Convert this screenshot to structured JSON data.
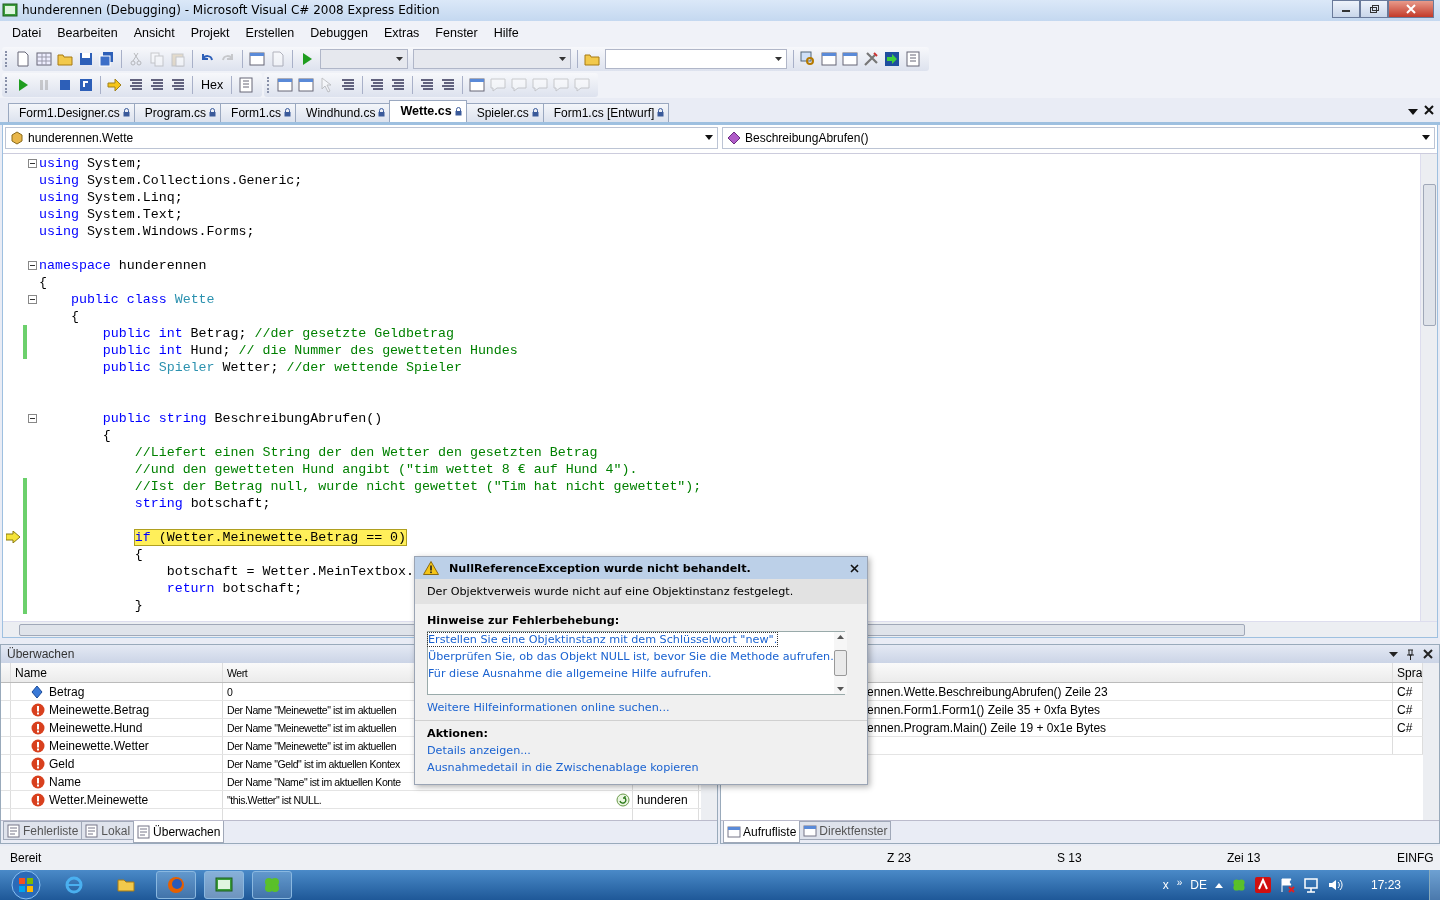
{
  "window": {
    "title": "hunderennen (Debugging) - Microsoft Visual C# 2008 Express Edition"
  },
  "menu": [
    "Datei",
    "Bearbeiten",
    "Ansicht",
    "Projekt",
    "Erstellen",
    "Debuggen",
    "Extras",
    "Fenster",
    "Hilfe"
  ],
  "toolbar": {
    "hex_button": "Hex"
  },
  "tabs": [
    {
      "label": "Form1.Designer.cs",
      "selected": false
    },
    {
      "label": "Program.cs",
      "selected": false
    },
    {
      "label": "Form1.cs",
      "selected": false
    },
    {
      "label": "Windhund.cs",
      "selected": false
    },
    {
      "label": "Wette.cs",
      "selected": true
    },
    {
      "label": "Spieler.cs",
      "selected": false
    },
    {
      "label": "Form1.cs [Entwurf]",
      "selected": false
    }
  ],
  "navigation": {
    "type": "hunderennen.Wette",
    "member": "BeschreibungAbrufen()"
  },
  "code": {
    "lines": [
      {
        "kind": "code",
        "fold": true,
        "changed": false,
        "current": false,
        "segments": [
          {
            "kind": "keyword",
            "text": "using"
          },
          {
            "kind": "plain",
            "text": " System;"
          }
        ]
      },
      {
        "kind": "code",
        "fold": false,
        "changed": false,
        "current": false,
        "segments": [
          {
            "kind": "keyword",
            "text": "using"
          },
          {
            "kind": "plain",
            "text": " System.Collections.Generic;"
          }
        ]
      },
      {
        "kind": "code",
        "fold": false,
        "changed": false,
        "current": false,
        "segments": [
          {
            "kind": "keyword",
            "text": "using"
          },
          {
            "kind": "plain",
            "text": " System.Linq;"
          }
        ]
      },
      {
        "kind": "code",
        "fold": false,
        "changed": false,
        "current": false,
        "segments": [
          {
            "kind": "keyword",
            "text": "using"
          },
          {
            "kind": "plain",
            "text": " System.Text;"
          }
        ]
      },
      {
        "kind": "code",
        "fold": false,
        "changed": false,
        "current": false,
        "segments": [
          {
            "kind": "keyword",
            "text": "using"
          },
          {
            "kind": "plain",
            "text": " System.Windows.Forms;"
          }
        ]
      },
      {
        "kind": "blank",
        "changed": false
      },
      {
        "kind": "code",
        "fold": true,
        "changed": false,
        "current": false,
        "segments": [
          {
            "kind": "keyword",
            "text": "namespace"
          },
          {
            "kind": "plain",
            "text": " hunderennen"
          }
        ]
      },
      {
        "kind": "code",
        "fold": false,
        "changed": false,
        "current": false,
        "segments": [
          {
            "kind": "plain",
            "text": "{"
          }
        ]
      },
      {
        "kind": "code",
        "fold": true,
        "changed": false,
        "current": false,
        "segments": [
          {
            "kind": "keyword",
            "text": "    public class"
          },
          {
            "kind": "type",
            "text": " Wette"
          }
        ]
      },
      {
        "kind": "code",
        "fold": false,
        "changed": false,
        "current": false,
        "segments": [
          {
            "kind": "plain",
            "text": "    {"
          }
        ]
      },
      {
        "kind": "code",
        "fold": false,
        "changed": true,
        "current": false,
        "segments": [
          {
            "kind": "keyword",
            "text": "        public int"
          },
          {
            "kind": "plain",
            "text": " Betrag; "
          },
          {
            "kind": "comment",
            "text": "//der gesetzte Geldbetrag"
          }
        ]
      },
      {
        "kind": "code",
        "fold": false,
        "changed": true,
        "current": false,
        "segments": [
          {
            "kind": "keyword",
            "text": "        public int"
          },
          {
            "kind": "plain",
            "text": " Hund; "
          },
          {
            "kind": "comment",
            "text": "// die Nummer des gewetteten Hundes"
          }
        ]
      },
      {
        "kind": "code",
        "fold": false,
        "changed": false,
        "current": false,
        "segments": [
          {
            "kind": "keyword",
            "text": "        public"
          },
          {
            "kind": "type",
            "text": " Spieler"
          },
          {
            "kind": "plain",
            "text": " Wetter; "
          },
          {
            "kind": "comment",
            "text": "//der wettende Spieler"
          }
        ]
      },
      {
        "kind": "blank",
        "changed": false
      },
      {
        "kind": "blank",
        "changed": false
      },
      {
        "kind": "code",
        "fold": true,
        "changed": false,
        "current": false,
        "segments": [
          {
            "kind": "keyword",
            "text": "        public string"
          },
          {
            "kind": "plain",
            "text": " BeschreibungAbrufen()"
          }
        ]
      },
      {
        "kind": "code",
        "fold": false,
        "changed": false,
        "current": false,
        "segments": [
          {
            "kind": "plain",
            "text": "        {"
          }
        ]
      },
      {
        "kind": "code",
        "fold": false,
        "changed": false,
        "current": false,
        "segments": [
          {
            "kind": "comment",
            "text": "            //Liefert einen String der den Wetter den gesetzten Betrag"
          }
        ]
      },
      {
        "kind": "code",
        "fold": false,
        "changed": false,
        "current": false,
        "segments": [
          {
            "kind": "comment",
            "text": "            //und den gewetteten Hund angibt (\"tim wettet 8 € auf Hund 4\")."
          }
        ]
      },
      {
        "kind": "code",
        "fold": false,
        "changed": true,
        "current": false,
        "segments": [
          {
            "kind": "comment",
            "text": "            //Ist der Betrag null, wurde nicht gewettet (\"Tim hat nicht gewettet\");"
          }
        ]
      },
      {
        "kind": "code",
        "fold": false,
        "changed": true,
        "current": false,
        "segments": [
          {
            "kind": "keyword",
            "text": "            string"
          },
          {
            "kind": "plain",
            "text": " botschaft;"
          }
        ]
      },
      {
        "kind": "blank",
        "changed": true
      },
      {
        "kind": "code",
        "fold": false,
        "changed": true,
        "current": true,
        "segments": [
          {
            "kind": "keyword",
            "text": "            if"
          },
          {
            "kind": "plain",
            "text": " (Wetter.Meinewette.Betrag == 0)"
          }
        ]
      },
      {
        "kind": "code",
        "fold": false,
        "changed": true,
        "current": false,
        "segments": [
          {
            "kind": "plain",
            "text": "            {"
          }
        ]
      },
      {
        "kind": "code",
        "fold": false,
        "changed": true,
        "current": false,
        "segments": [
          {
            "kind": "plain",
            "text": "                botschaft = Wetter.MeinTextbox."
          }
        ]
      },
      {
        "kind": "code",
        "fold": false,
        "changed": true,
        "current": false,
        "segments": [
          {
            "kind": "keyword",
            "text": "                return"
          },
          {
            "kind": "plain",
            "text": " botschaft;"
          }
        ]
      },
      {
        "kind": "code",
        "fold": false,
        "changed": true,
        "current": false,
        "segments": [
          {
            "kind": "plain",
            "text": "            }"
          }
        ]
      }
    ]
  },
  "exception": {
    "title": "NullReferenceException wurde nicht behandelt.",
    "message": "Der Objektverweis wurde nicht auf eine Objektinstanz festgelegt.",
    "tips_heading": "Hinweise zur Fehlerbehebung:",
    "tips": [
      {
        "text": "Erstellen Sie eine Objektinstanz mit dem Schlüsselwort \"new\".",
        "selected": true
      },
      {
        "text": "Überprüfen Sie, ob das Objekt NULL ist, bevor Sie die Methode aufrufen.",
        "selected": false
      },
      {
        "text": "Für diese Ausnahme die allgemeine Hilfe aufrufen.",
        "selected": false
      }
    ],
    "online_link": "Weitere Hilfeinformationen online suchen...",
    "actions_heading": "Aktionen:",
    "actions": [
      "Details anzeigen...",
      "Ausnahmedetail in die Zwischenablage kopieren"
    ]
  },
  "watch": {
    "title": "Überwachen",
    "columns": [
      "Name",
      "Wert"
    ],
    "rows": [
      {
        "kind": "property",
        "name": "Betrag",
        "value": "0"
      },
      {
        "kind": "error",
        "name": "Meinewette.Betrag",
        "value": "Der Name \"Meinewette\" ist im aktuellen"
      },
      {
        "kind": "error",
        "name": "Meinewette.Hund",
        "value": "Der Name \"Meinewette\" ist im aktuellen"
      },
      {
        "kind": "error",
        "name": "Meinewette.Wetter",
        "value": "Der Name \"Meinewette\" ist im aktuellen"
      },
      {
        "kind": "error",
        "name": "Geld",
        "value": "Der Name \"Geld\" ist im aktuellen Kontex"
      },
      {
        "kind": "error",
        "name": "Name",
        "value": "Der Name \"Name\" ist im aktuellen Konte"
      },
      {
        "kind": "error",
        "name": "Wetter.Meinewette",
        "value": "\"this.Wetter\" ist NULL.",
        "type": "hunderen"
      }
    ]
  },
  "callstack": {
    "columns": [
      "Spra"
    ],
    "rows": [
      {
        "name": "ennen.Wette.BeschreibungAbrufen() Zeile 23",
        "language": "C#"
      },
      {
        "name": "ennen.Form1.Form1() Zeile 35 + 0xfa Bytes",
        "language": "C#"
      },
      {
        "name": "ennen.Program.Main() Zeile 19 + 0x1e Bytes",
        "language": "C#"
      }
    ]
  },
  "bottom_left_tabs": [
    {
      "label": "Fehlerliste",
      "selected": false
    },
    {
      "label": "Lokal",
      "selected": false
    },
    {
      "label": "Überwachen",
      "selected": true
    }
  ],
  "bottom_right_tabs": [
    {
      "label": "Aufrufliste",
      "selected": true
    },
    {
      "label": "Direktfenster",
      "selected": false
    }
  ],
  "status_bar": {
    "text": "Bereit",
    "line": "Z 23",
    "column": "S 13",
    "char": "Zei 13",
    "mode": "EINFG"
  },
  "taskbar": {
    "tray_mark": "x",
    "expand": "»",
    "language": "DE",
    "time": "17:23"
  }
}
